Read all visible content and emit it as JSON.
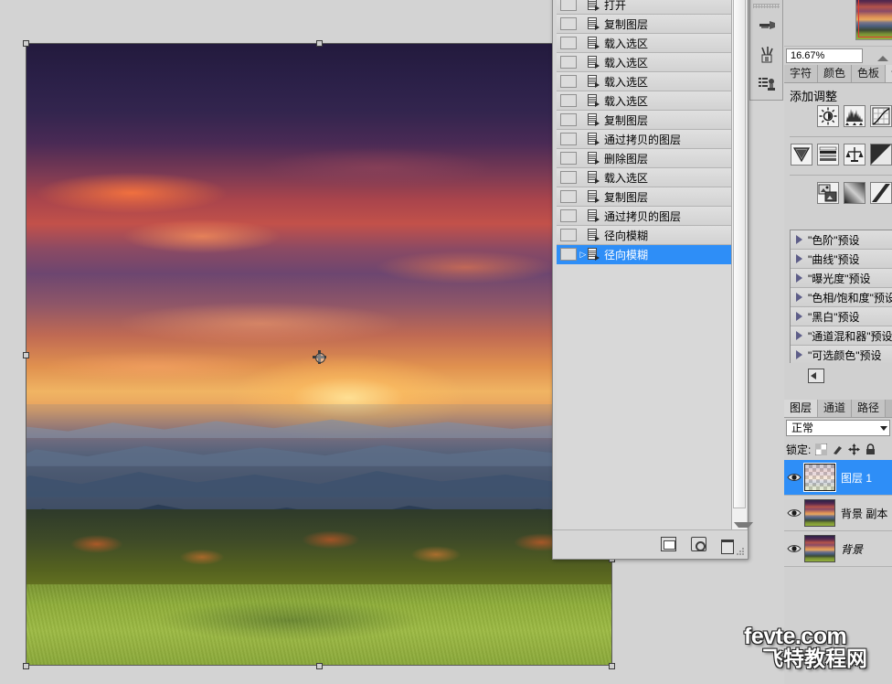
{
  "document": {
    "zoom_level": "16.67%",
    "image_alt": "sunset over autumn mountains with meadow"
  },
  "history_panel": {
    "items": [
      {
        "label": "打开",
        "selected": false,
        "marker": false
      },
      {
        "label": "复制图层",
        "selected": false,
        "marker": false
      },
      {
        "label": "载入选区",
        "selected": false,
        "marker": false
      },
      {
        "label": "载入选区",
        "selected": false,
        "marker": false
      },
      {
        "label": "载入选区",
        "selected": false,
        "marker": false
      },
      {
        "label": "载入选区",
        "selected": false,
        "marker": false
      },
      {
        "label": "复制图层",
        "selected": false,
        "marker": false
      },
      {
        "label": "通过拷贝的图层",
        "selected": false,
        "marker": false
      },
      {
        "label": "删除图层",
        "selected": false,
        "marker": false
      },
      {
        "label": "载入选区",
        "selected": false,
        "marker": false
      },
      {
        "label": "复制图层",
        "selected": false,
        "marker": false
      },
      {
        "label": "通过拷贝的图层",
        "selected": false,
        "marker": false
      },
      {
        "label": "径向模糊",
        "selected": false,
        "marker": false
      },
      {
        "label": "径向模糊",
        "selected": true,
        "marker": true
      }
    ],
    "footer_buttons": [
      {
        "name": "new-document-from-state",
        "label": "从当前状态创建新文档"
      },
      {
        "name": "new-snapshot",
        "label": "创建新快照"
      },
      {
        "name": "delete-state",
        "label": "删除当前状态"
      }
    ]
  },
  "tool_dock": {
    "buttons": [
      {
        "name": "brush-presets",
        "label": "画笔预设"
      },
      {
        "name": "tool-presets",
        "label": "工具预设"
      },
      {
        "name": "clone-source",
        "label": "仿制源"
      }
    ]
  },
  "adjustments_panel": {
    "tabs": [
      {
        "label": "字符",
        "active": false
      },
      {
        "label": "颜色",
        "active": false
      },
      {
        "label": "色板",
        "active": false
      },
      {
        "label": "调",
        "active": true
      }
    ],
    "title": "添加调整",
    "icons": [
      {
        "name": "brightness-contrast-icon",
        "label": "亮度/对比度"
      },
      {
        "name": "levels-icon",
        "label": "色阶"
      },
      {
        "name": "curves-icon",
        "label": "曲线"
      },
      {
        "name": "exposure-icon",
        "label": "曝光度"
      },
      {
        "name": "vibrance-icon",
        "label": "自然饱和度"
      },
      {
        "name": "hue-saturation-icon",
        "label": "色相/饱和度"
      },
      {
        "name": "color-balance-icon",
        "label": "色彩平衡"
      },
      {
        "name": "black-white-icon",
        "label": "黑白"
      },
      {
        "name": "photo-filter-icon",
        "label": "照片滤镜"
      },
      {
        "name": "channel-mixer-icon",
        "label": "通道混合器"
      }
    ],
    "presets": [
      {
        "label": "\"色阶\"预设"
      },
      {
        "label": "\"曲线\"预设"
      },
      {
        "label": "\"曝光度\"预设"
      },
      {
        "label": "\"色相/饱和度\"预设"
      },
      {
        "label": "\"黑白\"预设"
      },
      {
        "label": "\"通道混和器\"预设"
      },
      {
        "label": "\"可选颜色\"预设"
      }
    ],
    "footer_button": {
      "name": "return-to-adjustment-list",
      "label": "返回调整列表"
    }
  },
  "layers_panel": {
    "tabs": [
      {
        "label": "图层",
        "active": true
      },
      {
        "label": "通道",
        "active": false
      },
      {
        "label": "路径",
        "active": false
      }
    ],
    "blend_mode": "正常",
    "lock_label": "锁定:",
    "lock_icons": [
      {
        "name": "lock-transparent-pixels-icon",
        "label": "锁定透明像素"
      },
      {
        "name": "lock-image-pixels-icon",
        "label": "锁定图像像素"
      },
      {
        "name": "lock-position-icon",
        "label": "锁定位置"
      },
      {
        "name": "lock-all-icon",
        "label": "锁定全部"
      }
    ],
    "layers": [
      {
        "name": "图层 1",
        "selected": true,
        "visible": true,
        "italic": false,
        "thumb": "transparent"
      },
      {
        "name": "背景 副本",
        "selected": false,
        "visible": true,
        "italic": false,
        "thumb": "photo"
      },
      {
        "name": "背景",
        "selected": false,
        "visible": true,
        "italic": true,
        "thumb": "photo"
      }
    ]
  },
  "watermark": {
    "line1": "fevte.com",
    "line2": "飞特教程网"
  }
}
